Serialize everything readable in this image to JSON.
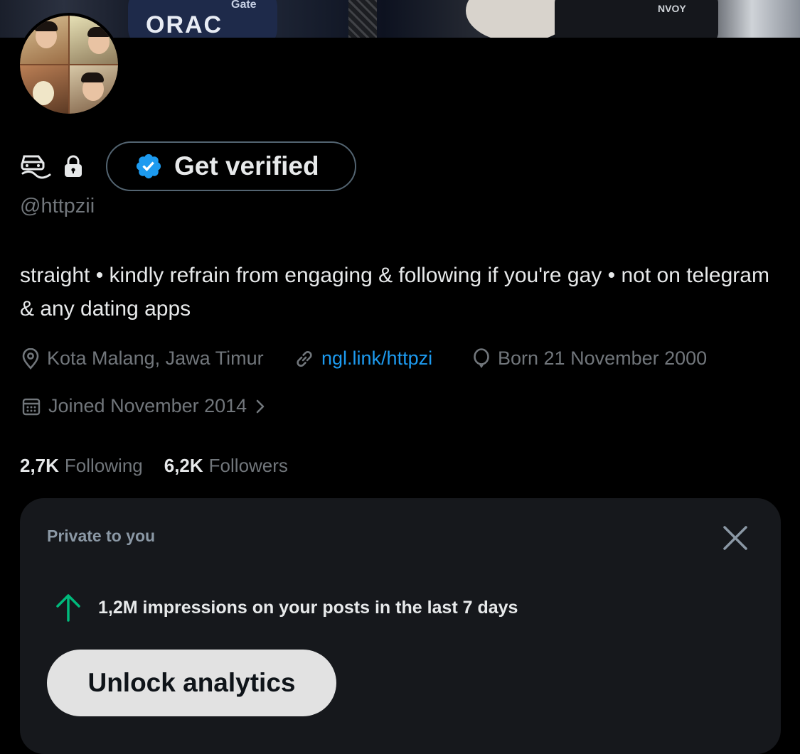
{
  "banner": {
    "sponsor_main": "ORAC",
    "sponsor_small": "Gate",
    "sponsor_right": "NVOY"
  },
  "profile": {
    "get_verified_label": "Get verified",
    "handle": "@httpzii",
    "bio": "straight • kindly refrain from engaging & following if you're gay • not on telegram & any dating apps",
    "location": "Kota Malang, Jawa Timur",
    "link": "ngl.link/httpzi",
    "birthday": "Born 21 November 2000",
    "joined": "Joined November 2014"
  },
  "stats": {
    "following_count": "2,7K",
    "following_label": "Following",
    "followers_count": "6,2K",
    "followers_label": "Followers"
  },
  "analytics_card": {
    "title": "Private to you",
    "impressions_text": "1,2M impressions on your posts in the last 7 days",
    "button_label": "Unlock analytics"
  },
  "colors": {
    "background": "#000000",
    "text_primary": "#e7e9ea",
    "text_secondary": "#71767b",
    "link": "#1d9bf0",
    "verified_badge": "#1d9bf0",
    "trend_up": "#00ba7c",
    "card_bg": "#16181c"
  },
  "icons": {
    "header_left": "shield-car-icon",
    "lock": "lock-icon",
    "verified": "verified-badge-icon",
    "location": "location-pin-icon",
    "link": "link-icon",
    "birthday": "balloon-icon",
    "joined": "calendar-icon",
    "chevron": "chevron-right-icon",
    "close": "close-icon",
    "trend": "arrow-up-icon"
  }
}
